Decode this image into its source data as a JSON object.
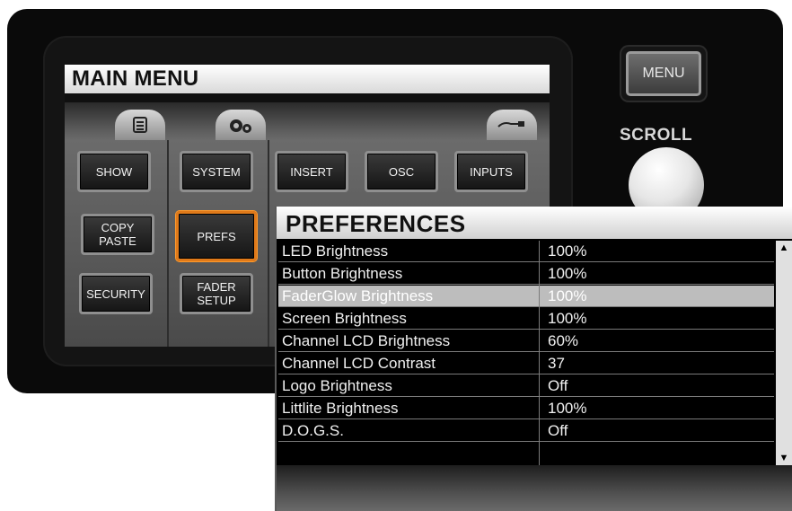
{
  "main_menu": {
    "title": "MAIN MENU",
    "tab_icons": [
      "list-icon",
      "gears-icon",
      "cable-icon"
    ],
    "buttons": [
      {
        "label_line1": "SHOW",
        "label_line2": ""
      },
      {
        "label_line1": "SYSTEM",
        "label_line2": ""
      },
      {
        "label_line1": "INSERT",
        "label_line2": ""
      },
      {
        "label_line1": "OSC",
        "label_line2": ""
      },
      {
        "label_line1": "INPUTS",
        "label_line2": ""
      },
      {
        "label_line1": "COPY",
        "label_line2": "PASTE"
      },
      {
        "label_line1": "PREFS",
        "label_line2": ""
      },
      {
        "label_line1": "SECURITY",
        "label_line2": ""
      },
      {
        "label_line1": "FADER",
        "label_line2": "SETUP"
      }
    ],
    "selected": "PREFS"
  },
  "hardware": {
    "menu_label": "MENU",
    "scroll_label": "SCROLL"
  },
  "preferences": {
    "title": "PREFERENCES",
    "highlighted_row": "FaderGlow Brightness",
    "rows": [
      {
        "name": "LED Brightness",
        "value": "100%"
      },
      {
        "name": "Button Brightness",
        "value": "100%"
      },
      {
        "name": "FaderGlow Brightness",
        "value": "100%"
      },
      {
        "name": "Screen Brightness",
        "value": "100%"
      },
      {
        "name": "Channel LCD Brightness",
        "value": "60%"
      },
      {
        "name": "Channel LCD Contrast",
        "value": "37"
      },
      {
        "name": "Logo Brightness",
        "value": "Off"
      },
      {
        "name": "Littlite Brightness",
        "value": "100%"
      },
      {
        "name": "D.O.G.S.",
        "value": "Off"
      },
      {
        "name": "",
        "value": ""
      }
    ],
    "scroll_up_glyph": "▲",
    "scroll_down_glyph": "▼"
  },
  "colors": {
    "selection_border": "#e07a1a",
    "row_highlight": "#bdbdbd"
  }
}
